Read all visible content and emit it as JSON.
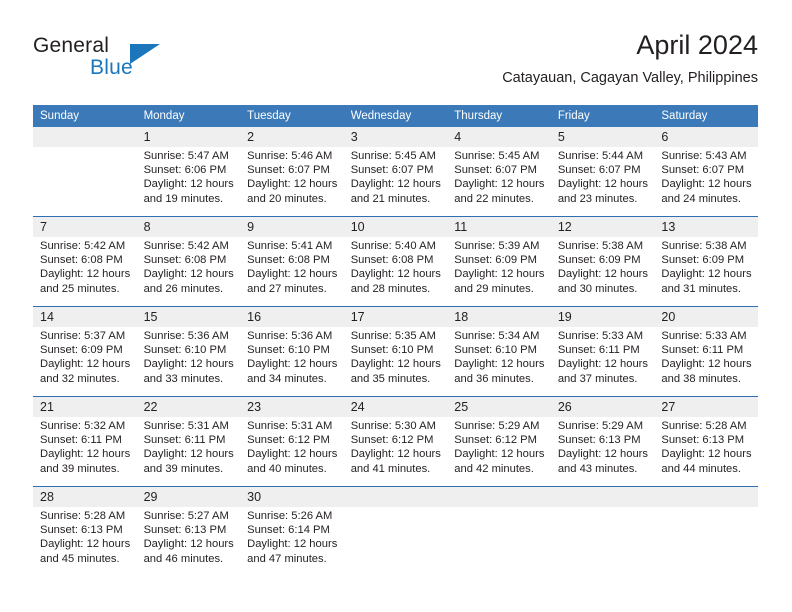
{
  "logo": {
    "word_one": "General",
    "word_two": "Blue",
    "accent_color": "#1b76bc",
    "triangle_icon": "triangle-icon"
  },
  "header": {
    "title": "April 2024",
    "location": "Catayauan, Cagayan Valley, Philippines"
  },
  "calendar": {
    "header_bg": "#3b79b8",
    "daynum_bg": "#efefef",
    "separator_color": "#2f6fb1",
    "weekdays": [
      "Sunday",
      "Monday",
      "Tuesday",
      "Wednesday",
      "Thursday",
      "Friday",
      "Saturday"
    ],
    "weeks": [
      [
        {
          "day": "",
          "lines": []
        },
        {
          "day": "1",
          "lines": [
            "Sunrise: 5:47 AM",
            "Sunset: 6:06 PM",
            "Daylight: 12 hours",
            "and 19 minutes."
          ]
        },
        {
          "day": "2",
          "lines": [
            "Sunrise: 5:46 AM",
            "Sunset: 6:07 PM",
            "Daylight: 12 hours",
            "and 20 minutes."
          ]
        },
        {
          "day": "3",
          "lines": [
            "Sunrise: 5:45 AM",
            "Sunset: 6:07 PM",
            "Daylight: 12 hours",
            "and 21 minutes."
          ]
        },
        {
          "day": "4",
          "lines": [
            "Sunrise: 5:45 AM",
            "Sunset: 6:07 PM",
            "Daylight: 12 hours",
            "and 22 minutes."
          ]
        },
        {
          "day": "5",
          "lines": [
            "Sunrise: 5:44 AM",
            "Sunset: 6:07 PM",
            "Daylight: 12 hours",
            "and 23 minutes."
          ]
        },
        {
          "day": "6",
          "lines": [
            "Sunrise: 5:43 AM",
            "Sunset: 6:07 PM",
            "Daylight: 12 hours",
            "and 24 minutes."
          ]
        }
      ],
      [
        {
          "day": "7",
          "lines": [
            "Sunrise: 5:42 AM",
            "Sunset: 6:08 PM",
            "Daylight: 12 hours",
            "and 25 minutes."
          ]
        },
        {
          "day": "8",
          "lines": [
            "Sunrise: 5:42 AM",
            "Sunset: 6:08 PM",
            "Daylight: 12 hours",
            "and 26 minutes."
          ]
        },
        {
          "day": "9",
          "lines": [
            "Sunrise: 5:41 AM",
            "Sunset: 6:08 PM",
            "Daylight: 12 hours",
            "and 27 minutes."
          ]
        },
        {
          "day": "10",
          "lines": [
            "Sunrise: 5:40 AM",
            "Sunset: 6:08 PM",
            "Daylight: 12 hours",
            "and 28 minutes."
          ]
        },
        {
          "day": "11",
          "lines": [
            "Sunrise: 5:39 AM",
            "Sunset: 6:09 PM",
            "Daylight: 12 hours",
            "and 29 minutes."
          ]
        },
        {
          "day": "12",
          "lines": [
            "Sunrise: 5:38 AM",
            "Sunset: 6:09 PM",
            "Daylight: 12 hours",
            "and 30 minutes."
          ]
        },
        {
          "day": "13",
          "lines": [
            "Sunrise: 5:38 AM",
            "Sunset: 6:09 PM",
            "Daylight: 12 hours",
            "and 31 minutes."
          ]
        }
      ],
      [
        {
          "day": "14",
          "lines": [
            "Sunrise: 5:37 AM",
            "Sunset: 6:09 PM",
            "Daylight: 12 hours",
            "and 32 minutes."
          ]
        },
        {
          "day": "15",
          "lines": [
            "Sunrise: 5:36 AM",
            "Sunset: 6:10 PM",
            "Daylight: 12 hours",
            "and 33 minutes."
          ]
        },
        {
          "day": "16",
          "lines": [
            "Sunrise: 5:36 AM",
            "Sunset: 6:10 PM",
            "Daylight: 12 hours",
            "and 34 minutes."
          ]
        },
        {
          "day": "17",
          "lines": [
            "Sunrise: 5:35 AM",
            "Sunset: 6:10 PM",
            "Daylight: 12 hours",
            "and 35 minutes."
          ]
        },
        {
          "day": "18",
          "lines": [
            "Sunrise: 5:34 AM",
            "Sunset: 6:10 PM",
            "Daylight: 12 hours",
            "and 36 minutes."
          ]
        },
        {
          "day": "19",
          "lines": [
            "Sunrise: 5:33 AM",
            "Sunset: 6:11 PM",
            "Daylight: 12 hours",
            "and 37 minutes."
          ]
        },
        {
          "day": "20",
          "lines": [
            "Sunrise: 5:33 AM",
            "Sunset: 6:11 PM",
            "Daylight: 12 hours",
            "and 38 minutes."
          ]
        }
      ],
      [
        {
          "day": "21",
          "lines": [
            "Sunrise: 5:32 AM",
            "Sunset: 6:11 PM",
            "Daylight: 12 hours",
            "and 39 minutes."
          ]
        },
        {
          "day": "22",
          "lines": [
            "Sunrise: 5:31 AM",
            "Sunset: 6:11 PM",
            "Daylight: 12 hours",
            "and 39 minutes."
          ]
        },
        {
          "day": "23",
          "lines": [
            "Sunrise: 5:31 AM",
            "Sunset: 6:12 PM",
            "Daylight: 12 hours",
            "and 40 minutes."
          ]
        },
        {
          "day": "24",
          "lines": [
            "Sunrise: 5:30 AM",
            "Sunset: 6:12 PM",
            "Daylight: 12 hours",
            "and 41 minutes."
          ]
        },
        {
          "day": "25",
          "lines": [
            "Sunrise: 5:29 AM",
            "Sunset: 6:12 PM",
            "Daylight: 12 hours",
            "and 42 minutes."
          ]
        },
        {
          "day": "26",
          "lines": [
            "Sunrise: 5:29 AM",
            "Sunset: 6:13 PM",
            "Daylight: 12 hours",
            "and 43 minutes."
          ]
        },
        {
          "day": "27",
          "lines": [
            "Sunrise: 5:28 AM",
            "Sunset: 6:13 PM",
            "Daylight: 12 hours",
            "and 44 minutes."
          ]
        }
      ],
      [
        {
          "day": "28",
          "lines": [
            "Sunrise: 5:28 AM",
            "Sunset: 6:13 PM",
            "Daylight: 12 hours",
            "and 45 minutes."
          ]
        },
        {
          "day": "29",
          "lines": [
            "Sunrise: 5:27 AM",
            "Sunset: 6:13 PM",
            "Daylight: 12 hours",
            "and 46 minutes."
          ]
        },
        {
          "day": "30",
          "lines": [
            "Sunrise: 5:26 AM",
            "Sunset: 6:14 PM",
            "Daylight: 12 hours",
            "and 47 minutes."
          ]
        },
        {
          "day": "",
          "lines": []
        },
        {
          "day": "",
          "lines": []
        },
        {
          "day": "",
          "lines": []
        },
        {
          "day": "",
          "lines": []
        }
      ]
    ]
  }
}
